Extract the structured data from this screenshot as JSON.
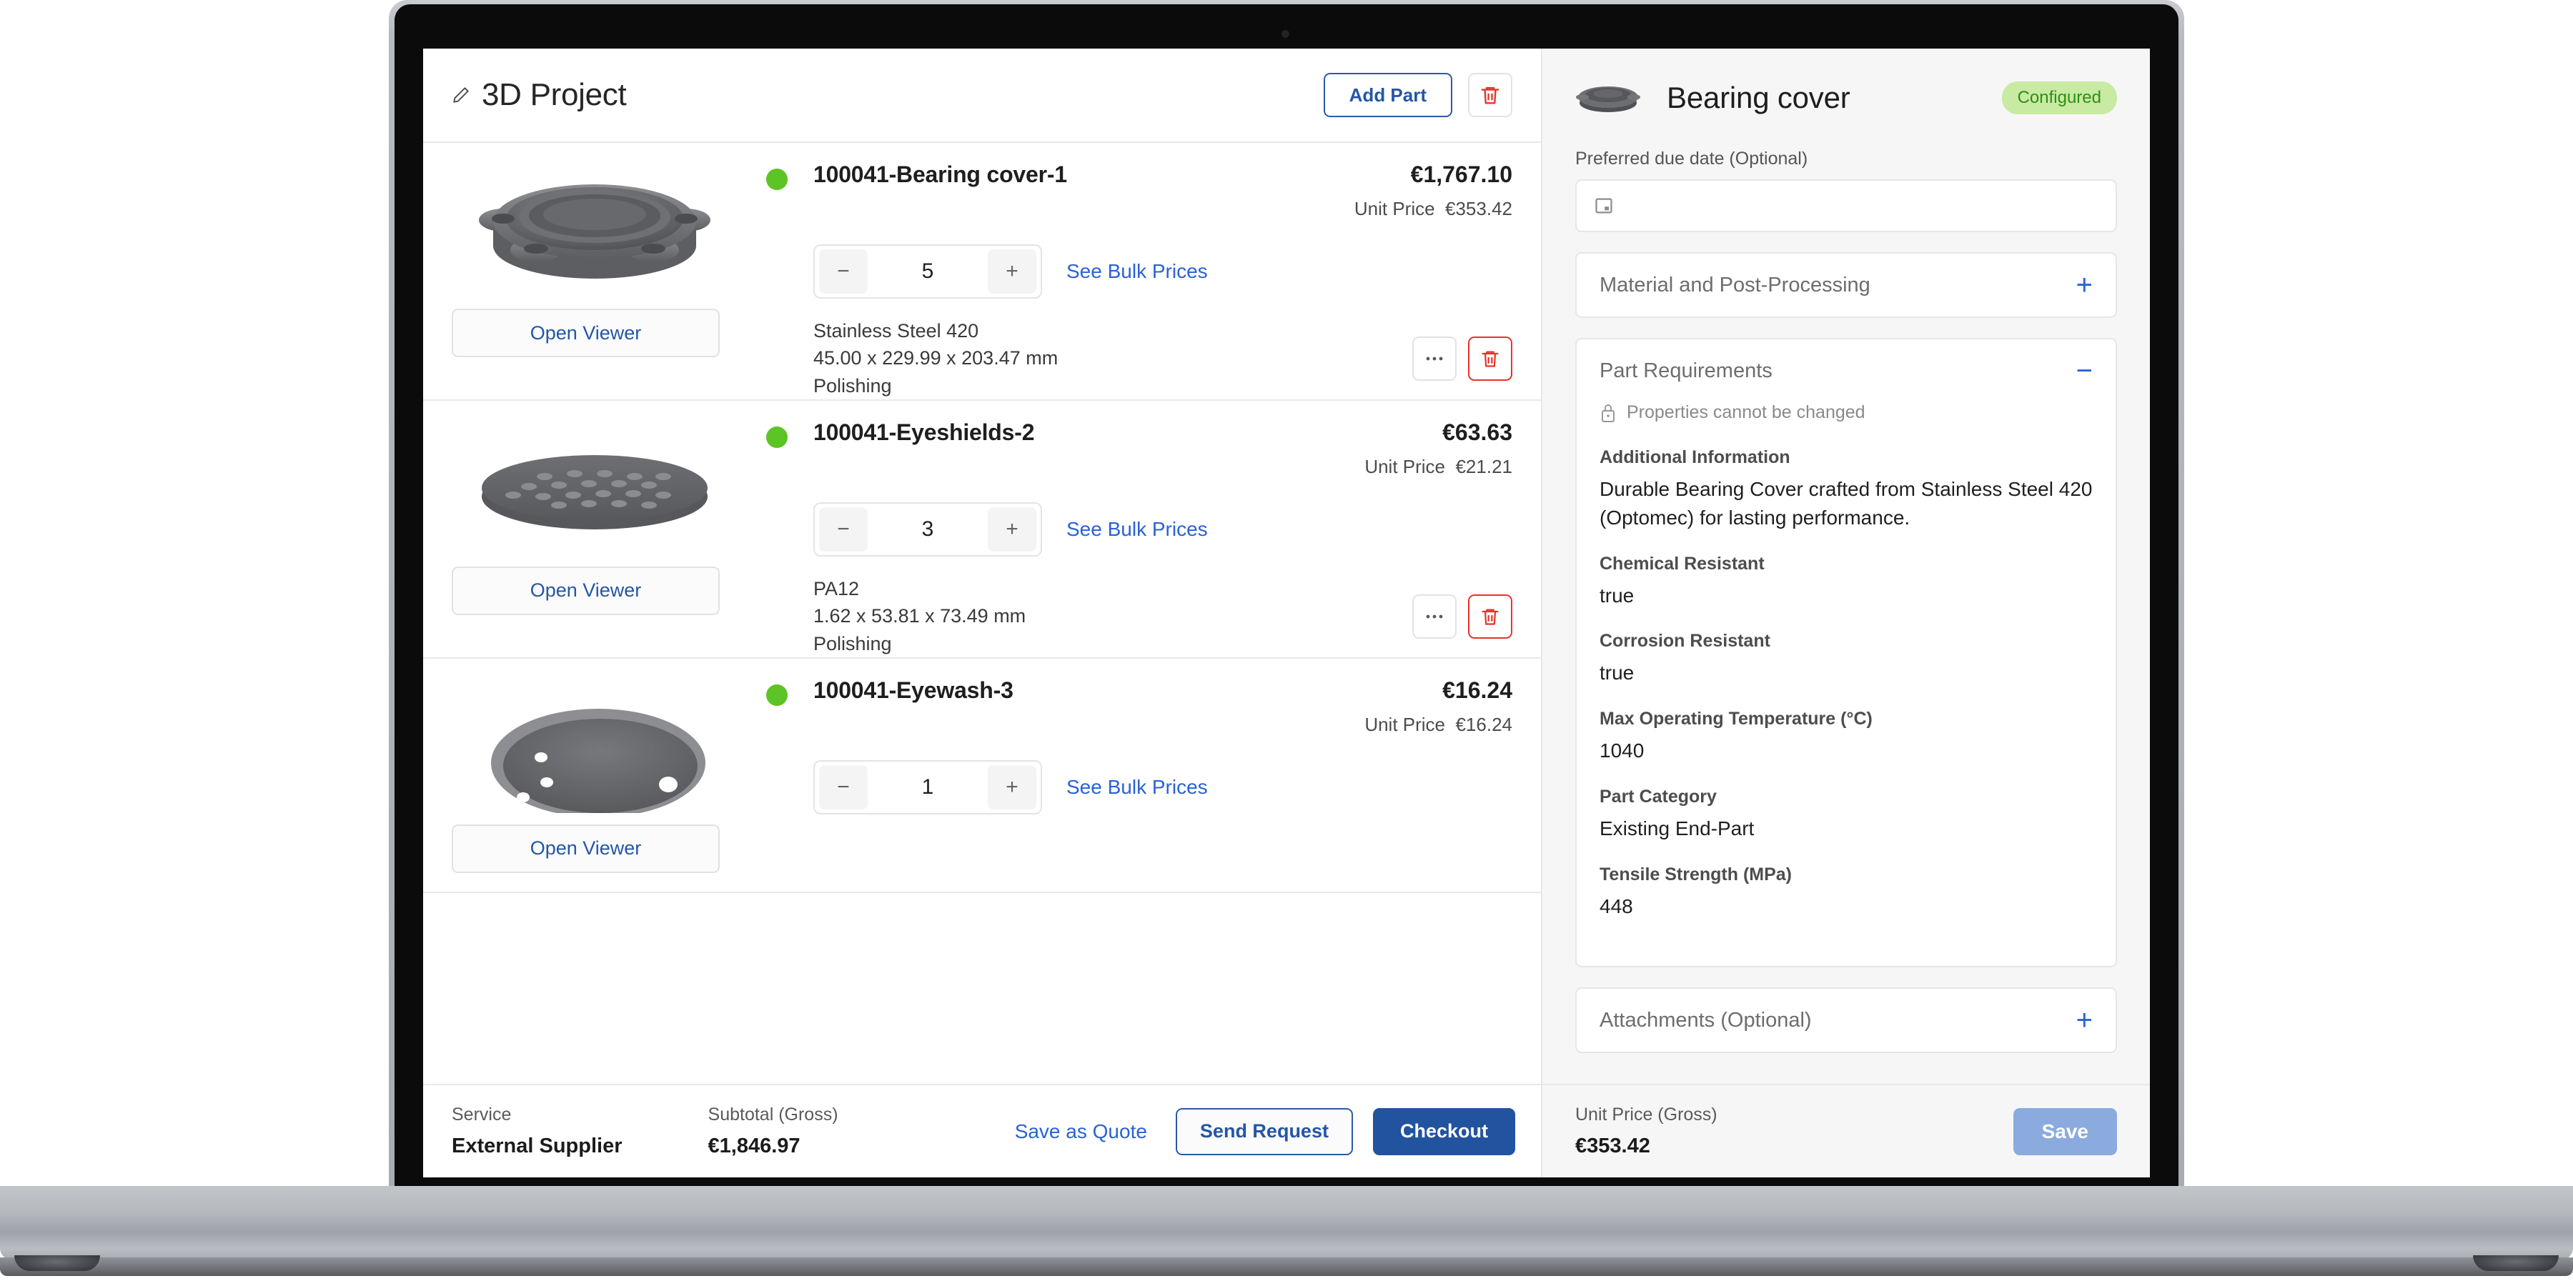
{
  "header": {
    "title": "3D Project",
    "edit_icon": "pencil-icon",
    "add_part_label": "Add Part",
    "delete_icon": "trash-icon"
  },
  "parts": [
    {
      "name": "100041-Bearing cover-1",
      "status": "green",
      "total_price": "€1,767.10",
      "unit_price_label": "Unit Price",
      "unit_price": "€353.42",
      "quantity": "5",
      "decrement": "−",
      "increment": "+",
      "bulk_link": "See Bulk Prices",
      "material": "Stainless Steel 420",
      "dimensions": "45.00 x 229.99 x 203.47 mm",
      "finish": "Polishing",
      "viewer_label": "Open Viewer",
      "thumb": "bearing-cover-thumbnail"
    },
    {
      "name": "100041-Eyeshields-2",
      "status": "green",
      "total_price": "€63.63",
      "unit_price_label": "Unit Price",
      "unit_price": "€21.21",
      "quantity": "3",
      "decrement": "−",
      "increment": "+",
      "bulk_link": "See Bulk Prices",
      "material": "PA12",
      "dimensions": "1.62 x 53.81 x 73.49 mm",
      "finish": "Polishing",
      "viewer_label": "Open Viewer",
      "thumb": "eyeshields-thumbnail"
    },
    {
      "name": "100041-Eyewash-3",
      "status": "green",
      "total_price": "€16.24",
      "unit_price_label": "Unit Price",
      "unit_price": "€16.24",
      "quantity": "1",
      "decrement": "−",
      "increment": "+",
      "bulk_link": "See Bulk Prices",
      "material": "",
      "dimensions": "",
      "finish": "",
      "viewer_label": "Open Viewer",
      "thumb": "eyewash-thumbnail"
    }
  ],
  "footer": {
    "service_label": "Service",
    "service_value": "External Supplier",
    "subtotal_label": "Subtotal (Gross)",
    "subtotal_value": "€1,846.97",
    "save_quote_label": "Save as Quote",
    "send_request_label": "Send Request",
    "checkout_label": "Checkout"
  },
  "detail": {
    "title": "Bearing cover",
    "badge": "Configured",
    "due_date_label": "Preferred due date (Optional)",
    "due_date_value": "",
    "calendar_icon": "calendar-icon",
    "sections": [
      {
        "title": "Material and Post-Processing",
        "sign": "+",
        "expanded": false
      },
      {
        "title": "Part Requirements",
        "sign": "−",
        "expanded": true
      },
      {
        "title": "Attachments (Optional)",
        "sign": "+",
        "expanded": false
      }
    ],
    "locked_note": "Properties cannot be changed",
    "lock_icon": "lock-icon",
    "properties": [
      {
        "key": "Additional Information",
        "value": "Durable Bearing Cover crafted from Stainless Steel 420 (Optomec) for lasting performance."
      },
      {
        "key": "Chemical Resistant",
        "value": "true"
      },
      {
        "key": "Corrosion Resistant",
        "value": "true"
      },
      {
        "key": "Max Operating Temperature (°C)",
        "value": "1040"
      },
      {
        "key": "Part Category",
        "value": "Existing End-Part"
      },
      {
        "key": "Tensile Strength (MPa)",
        "value": "448"
      }
    ],
    "unit_price_label": "Unit Price (Gross)",
    "unit_price_value": "€353.42",
    "save_label": "Save"
  },
  "colors": {
    "accent_blue": "#2a62d6",
    "primary_blue": "#22539f",
    "danger_red": "#e8332a",
    "status_green": "#5cc424",
    "badge_bg": "#c8eaa3",
    "badge_text": "#2f8f14"
  }
}
